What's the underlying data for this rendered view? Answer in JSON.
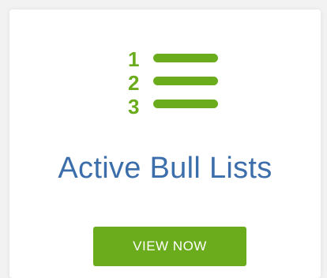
{
  "card": {
    "icon": "numbered-list-icon",
    "title": "Active Bull Lists",
    "button_label": "VIEW NOW"
  },
  "colors": {
    "accent_green": "#6aac1c",
    "title_blue": "#3b6eaa",
    "background": "#f2f2f2",
    "card_bg": "#ffffff"
  }
}
